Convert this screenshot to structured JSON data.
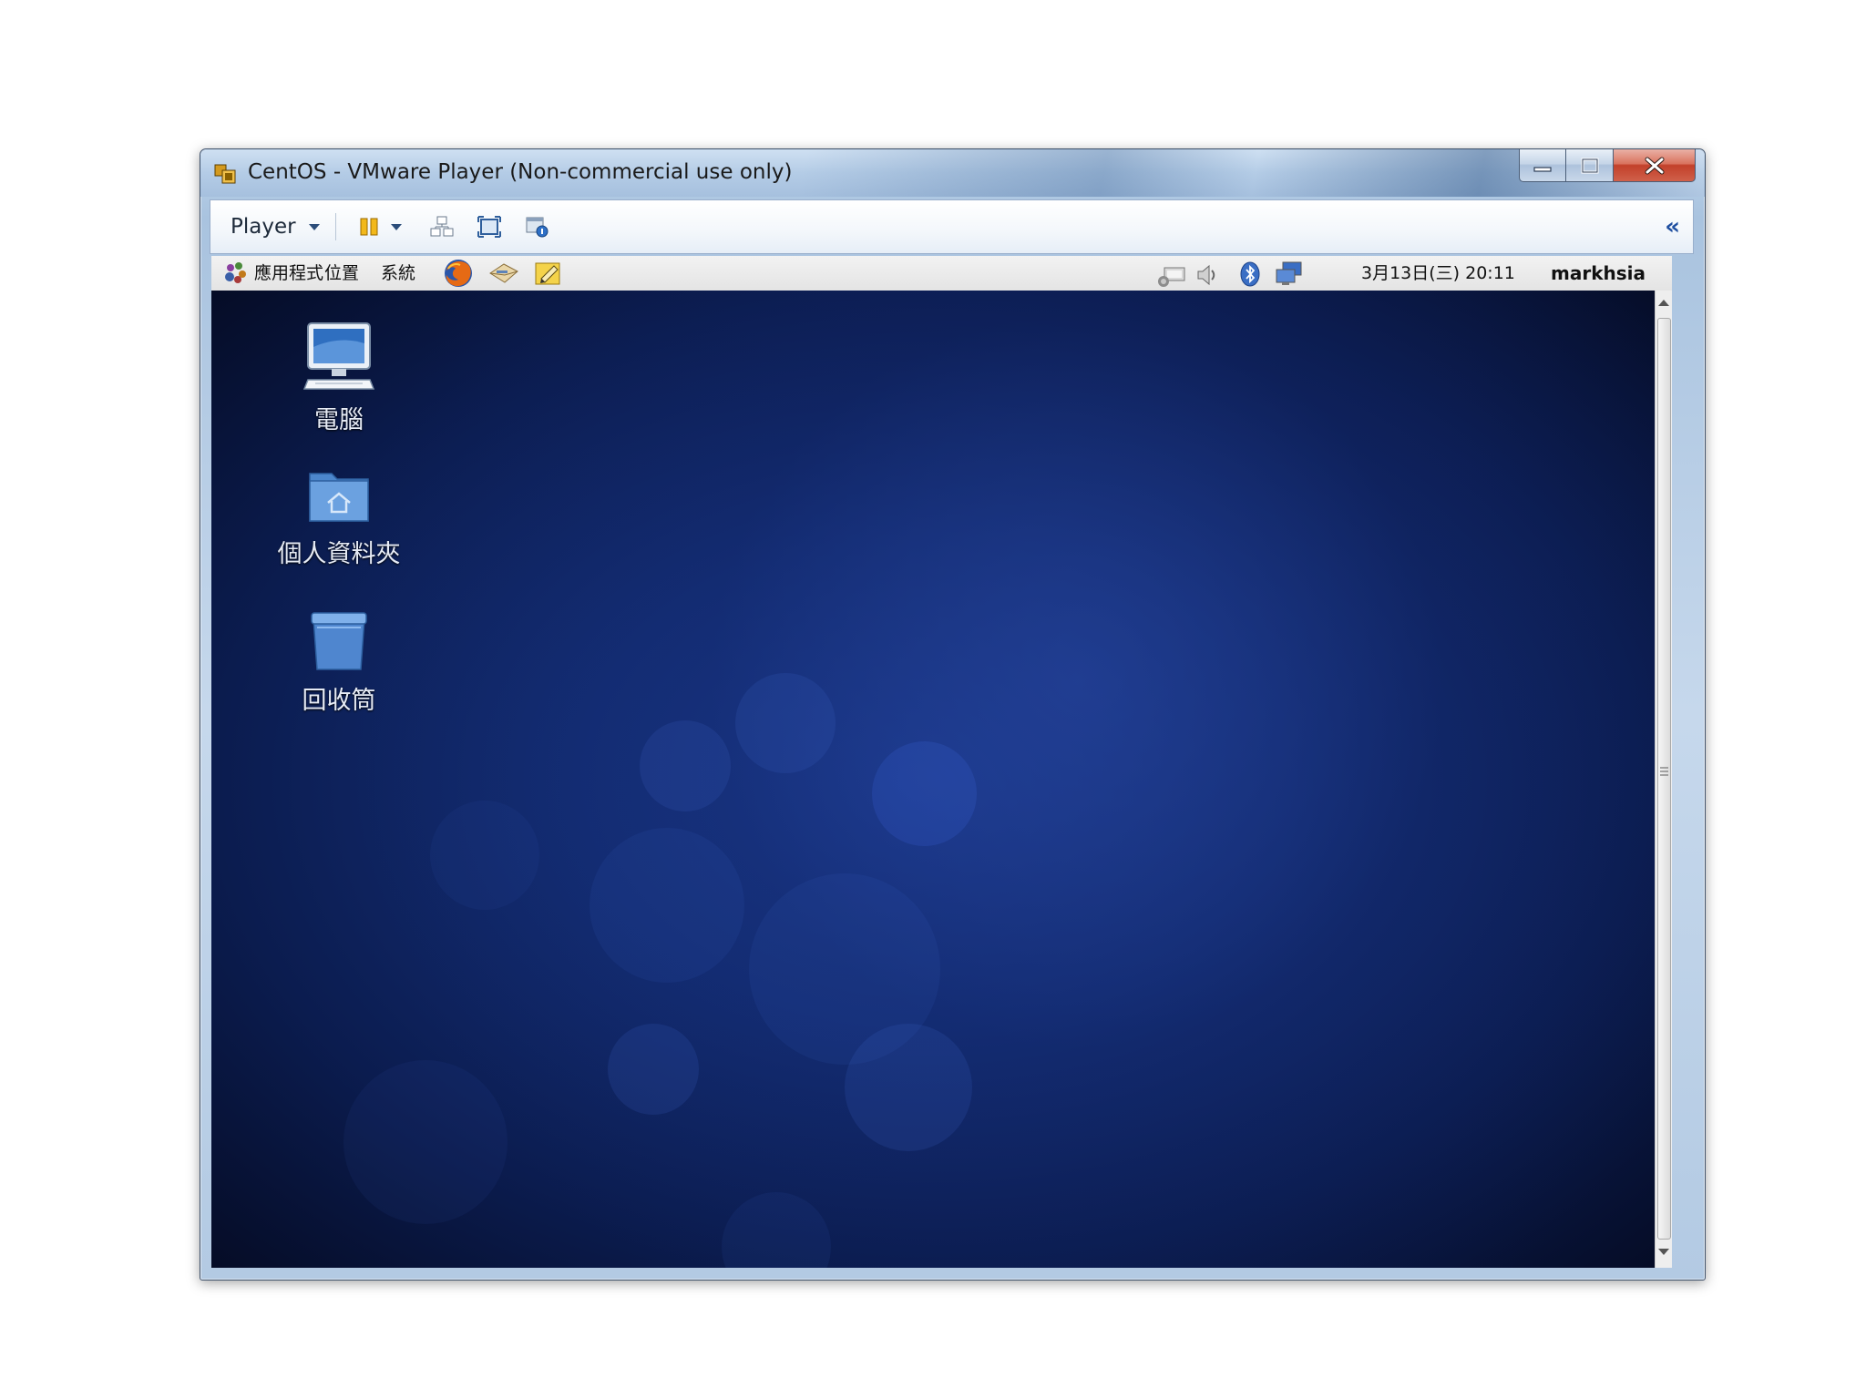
{
  "window": {
    "title": "CentOS - VMware Player (Non-commercial use only)",
    "controls": {
      "minimize": "minimize",
      "maximize": "maximize",
      "close": "close"
    }
  },
  "toolbar": {
    "player_label": "Player",
    "icons": [
      "pause-icon",
      "send-ctrl-alt-del-icon",
      "fullscreen-icon",
      "unity-icon"
    ],
    "collapse_label": "«"
  },
  "gnome_panel": {
    "menus": [
      "應用程式",
      "位置",
      "系統"
    ],
    "launchers": [
      "firefox-icon",
      "mail-client-icon",
      "notes-icon"
    ],
    "tray": [
      "network-icon",
      "volume-icon",
      "bluetooth-icon",
      "display-icon"
    ],
    "datetime": "3月13日(三) 20:11",
    "user": "markhsia"
  },
  "desktop": {
    "icons": [
      {
        "label": "電腦",
        "icon": "computer-icon"
      },
      {
        "label": "個人資料夾",
        "icon": "home-folder-icon"
      },
      {
        "label": "回收筒",
        "icon": "trash-icon"
      }
    ]
  },
  "colors": {
    "desktop_dark": "#050c26",
    "desktop_light": "#1b3a8e",
    "close_red": "#c2402a",
    "panel_gray": "#e4e4e4"
  }
}
